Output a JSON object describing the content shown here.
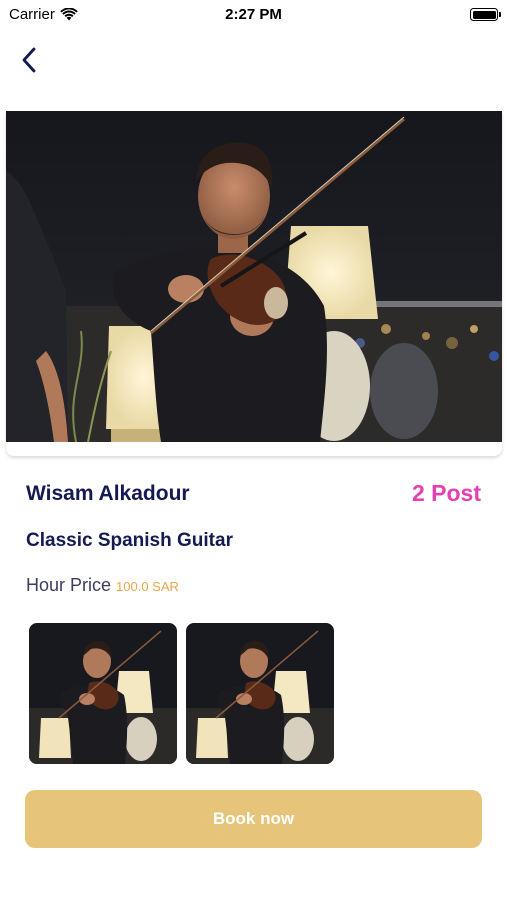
{
  "status_bar": {
    "carrier": "Carrier",
    "time": "2:27 PM",
    "icons": [
      "wifi-icon",
      "battery-icon"
    ]
  },
  "nav": {
    "back_icon": "chevron-left-icon"
  },
  "profile": {
    "name": "Wisam Alkadour",
    "posts": "2 Post",
    "category": "Classic Spanish Guitar",
    "hour_price_label": "Hour Price",
    "hour_price_value": "100.0 SAR"
  },
  "gallery": {
    "items": [
      "violinist-photo",
      "violinist-photo"
    ]
  },
  "actions": {
    "book_label": "Book now"
  },
  "colors": {
    "title_navy": "#141a52",
    "posts_pink": "#e53fb6",
    "price_orange": "#e8a64a",
    "book_button": "#e6c57b"
  }
}
